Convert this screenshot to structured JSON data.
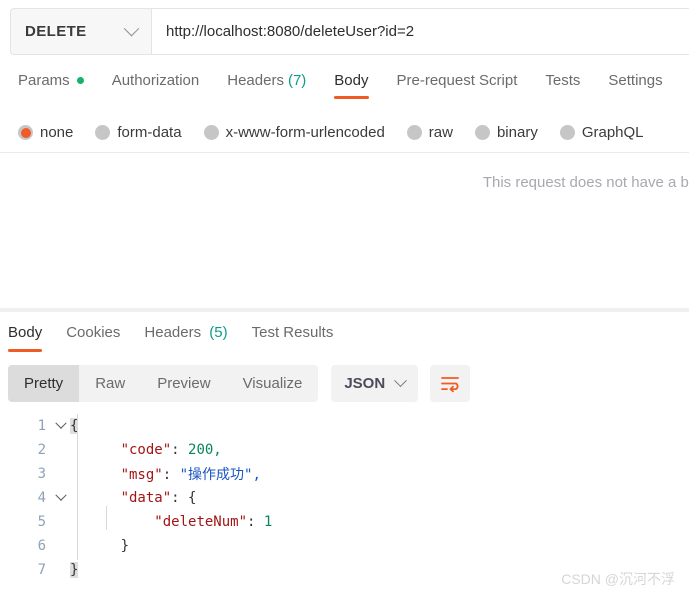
{
  "request": {
    "method": "DELETE",
    "method_dropdown_icon": "chevron-down-icon",
    "url": "http://localhost:8080/deleteUser?id=2",
    "tabs": [
      {
        "label": "Params",
        "active": false,
        "indicator": "green-dot",
        "count": ""
      },
      {
        "label": "Authorization",
        "active": false,
        "indicator": "",
        "count": ""
      },
      {
        "label": "Headers",
        "active": false,
        "indicator": "",
        "count": "(7)"
      },
      {
        "label": "Body",
        "active": true,
        "indicator": "",
        "count": ""
      },
      {
        "label": "Pre-request Script",
        "active": false,
        "indicator": "",
        "count": ""
      },
      {
        "label": "Tests",
        "active": false,
        "indicator": "",
        "count": ""
      },
      {
        "label": "Settings",
        "active": false,
        "indicator": "",
        "count": ""
      }
    ],
    "body_types": [
      {
        "label": "none",
        "selected": true
      },
      {
        "label": "form-data",
        "selected": false
      },
      {
        "label": "x-www-form-urlencoded",
        "selected": false
      },
      {
        "label": "binary",
        "selected": false
      },
      {
        "label": "raw",
        "selected": false
      },
      {
        "label": "GraphQL",
        "selected": false
      }
    ],
    "empty_body_message": "This request does not have a body"
  },
  "response": {
    "tabs": [
      {
        "label": "Body",
        "active": true,
        "count": ""
      },
      {
        "label": "Cookies",
        "active": false,
        "count": ""
      },
      {
        "label": "Headers",
        "active": false,
        "count": "(5)"
      },
      {
        "label": "Test Results",
        "active": false,
        "count": ""
      }
    ],
    "view_modes": [
      {
        "label": "Pretty",
        "active": true
      },
      {
        "label": "Raw",
        "active": false
      },
      {
        "label": "Preview",
        "active": false
      },
      {
        "label": "Visualize",
        "active": false
      }
    ],
    "format": "JSON",
    "format_dropdown_icon": "chevron-down-icon",
    "wrap_icon": "text-wrap-icon",
    "json_lines": [
      {
        "n": "1",
        "fold": true
      },
      {
        "n": "2",
        "fold": false
      },
      {
        "n": "3",
        "fold": false
      },
      {
        "n": "4",
        "fold": true
      },
      {
        "n": "5",
        "fold": false
      },
      {
        "n": "6",
        "fold": false
      },
      {
        "n": "7",
        "fold": false
      }
    ],
    "body_json": {
      "code": "200",
      "msg": "操作成功",
      "data": {
        "deleteNum": "1"
      }
    },
    "tokens": {
      "brace_open": "{",
      "brace_close": "}",
      "k_code": "\"code\"",
      "v_code": "200,",
      "k_msg": "\"msg\"",
      "v_msg": "\"操作成功\",",
      "k_data": "\"data\"",
      "k_deleteNum": "\"deleteNum\"",
      "v_deleteNum": "1",
      "colon": ": "
    }
  },
  "watermark": "CSDN @沉河不浮",
  "colors": {
    "accent": "#ef5b25",
    "radio_selected": "#f15a29",
    "params_dot": "#17b26a",
    "header_count": "#0d9c8a",
    "json_key": "#a31515",
    "json_number": "#098658",
    "json_string": "#1a56c4"
  }
}
